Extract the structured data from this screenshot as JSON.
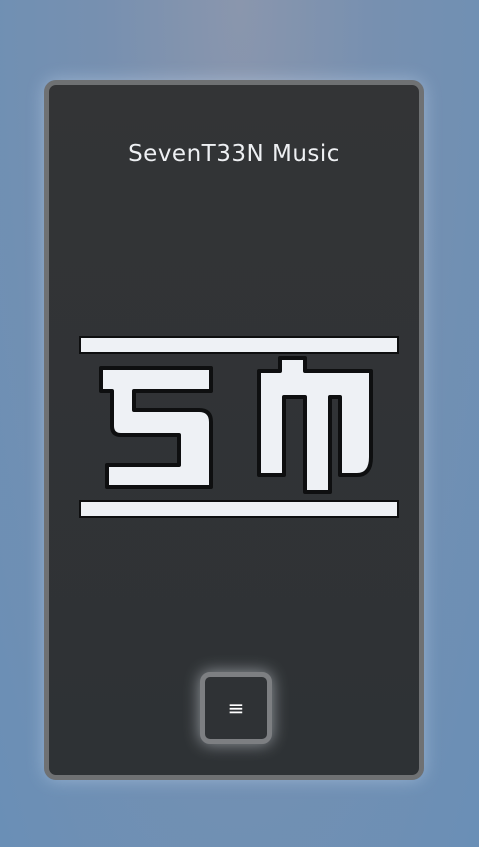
{
  "header": {
    "title": "SevenT33N Music"
  },
  "logo": {
    "text": "SM",
    "icon": "seventeen-music-logo"
  },
  "menu": {
    "icon": "hamburger-icon",
    "glyph": "≡"
  },
  "colors": {
    "card_background": "#333436",
    "card_border": "#6f7173",
    "text": "#eef0f3",
    "logo_fill": "#eef1f5",
    "logo_outline": "#0e0f10"
  }
}
